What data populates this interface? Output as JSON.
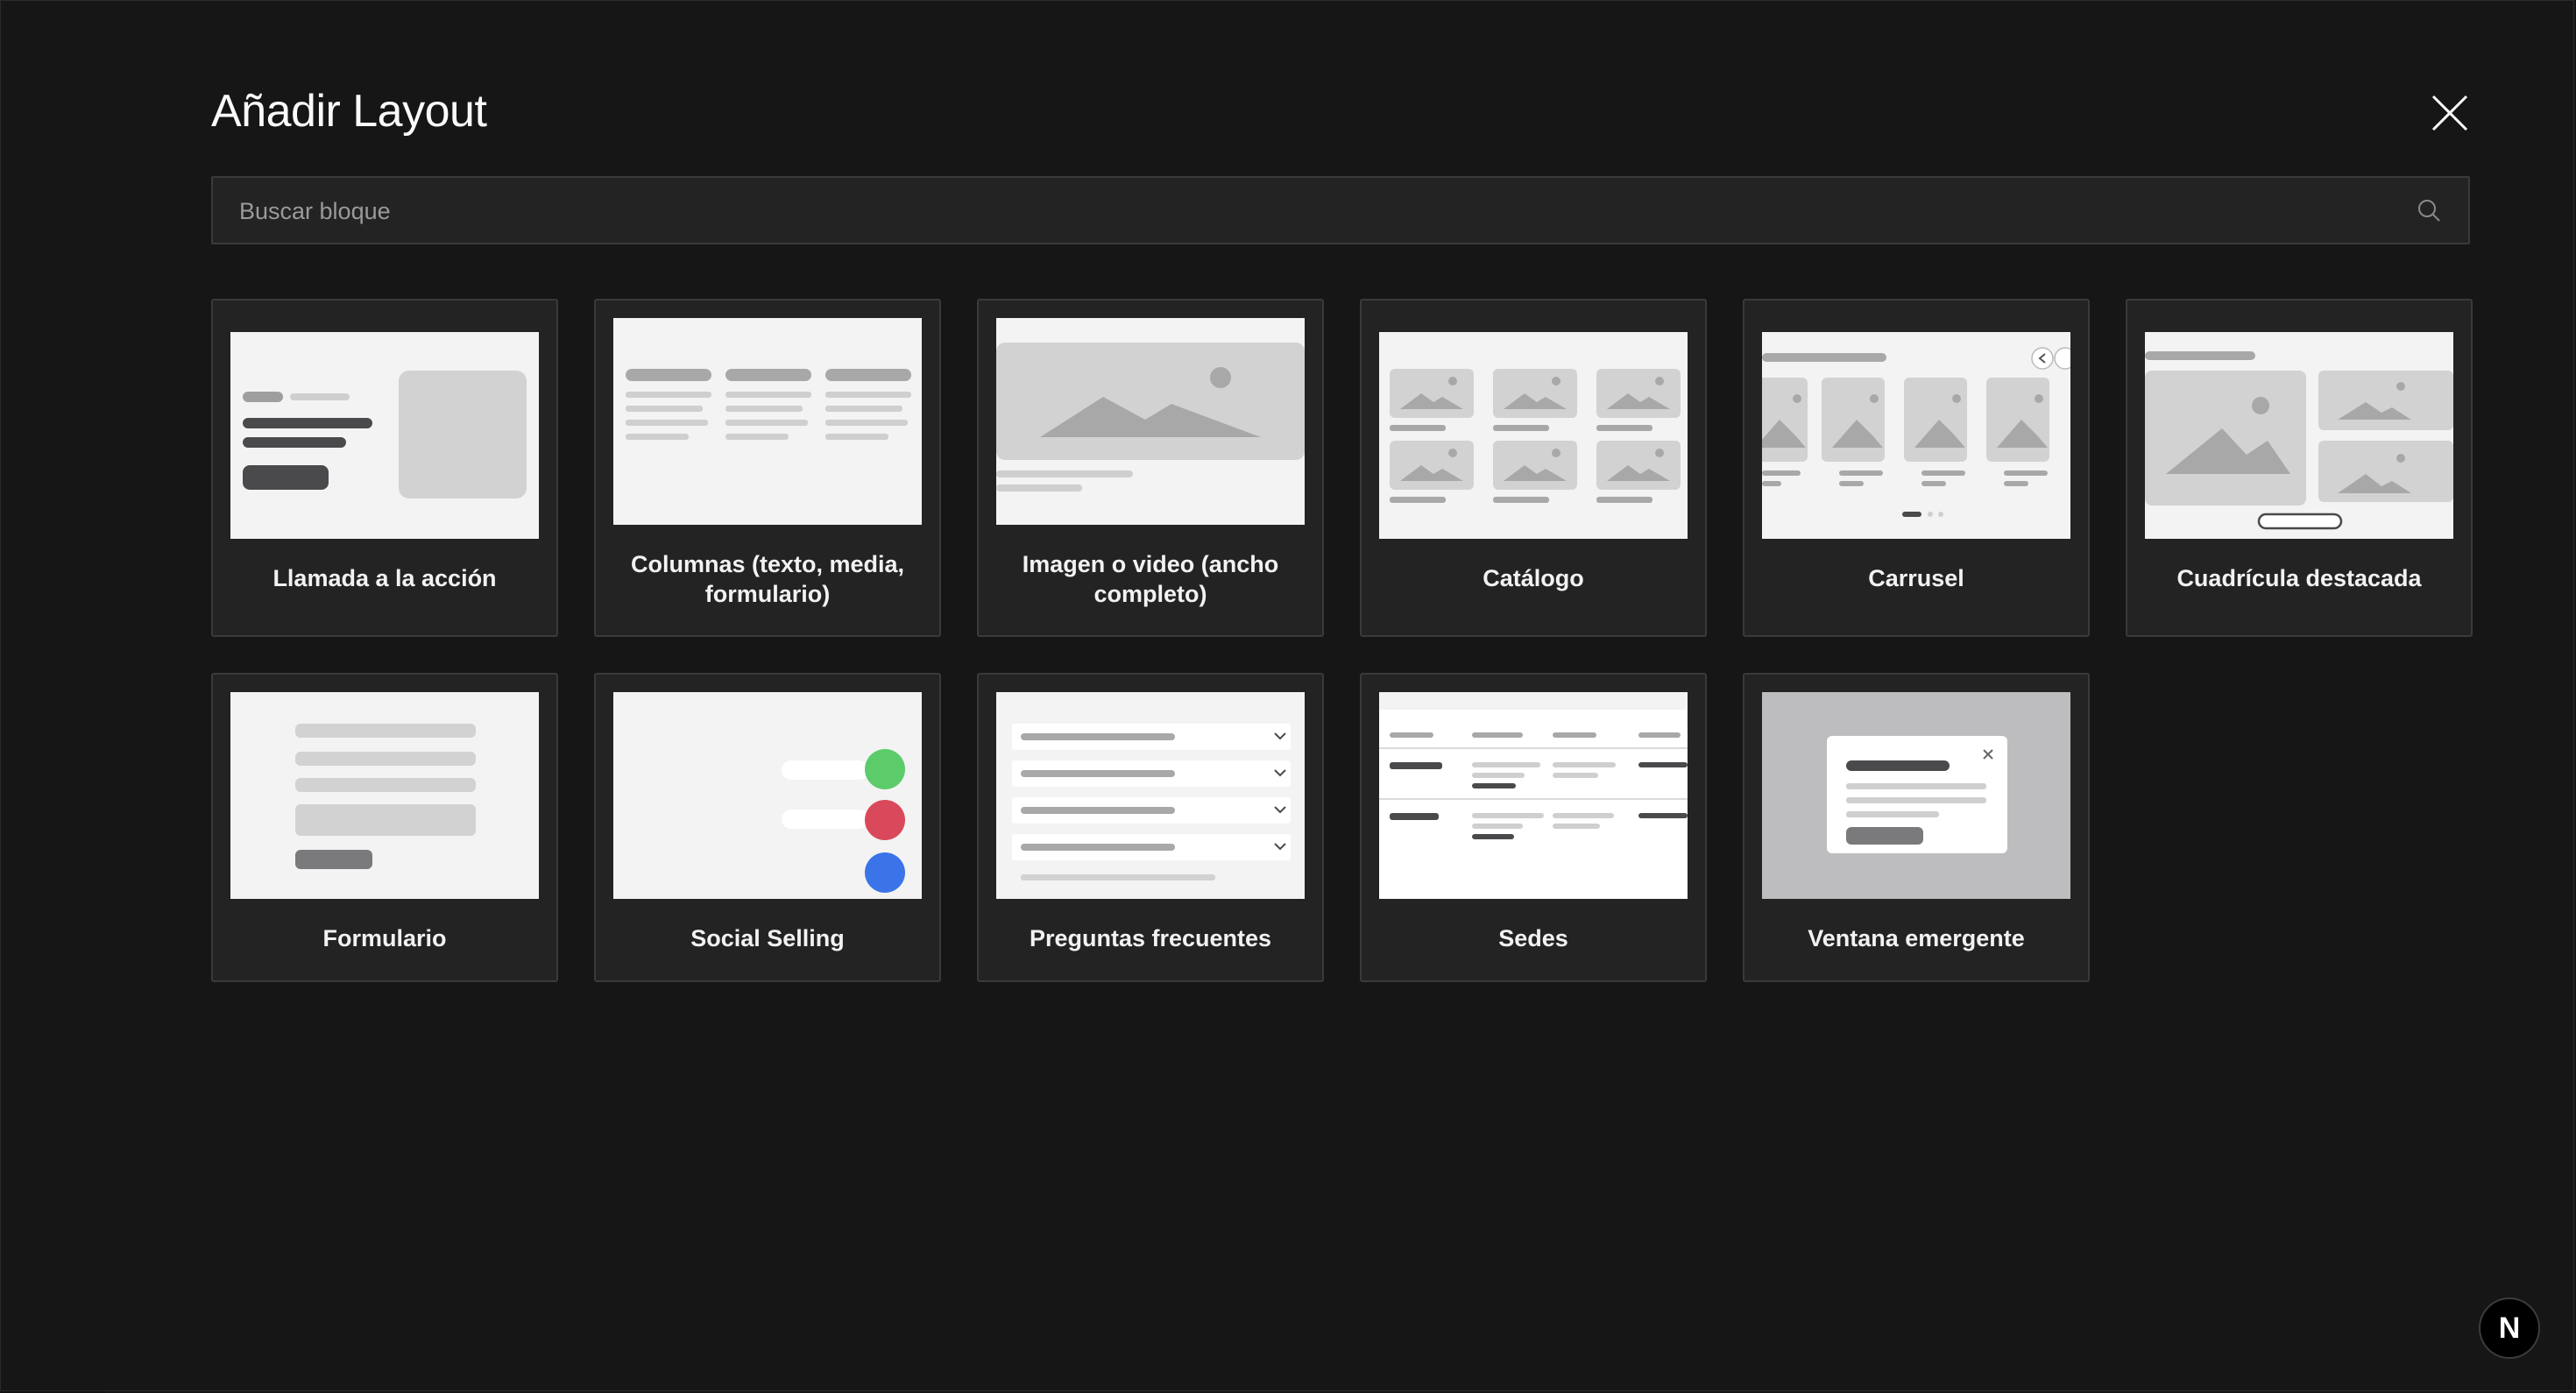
{
  "modal": {
    "title": "Añadir Layout",
    "close_icon": "close-icon"
  },
  "search": {
    "placeholder": "Buscar bloque",
    "value": "",
    "icon": "search-icon"
  },
  "blocks": [
    {
      "label": "Llamada a la acción"
    },
    {
      "label": "Columnas (texto, media, formulario)"
    },
    {
      "label": "Imagen o video (ancho completo)"
    },
    {
      "label": "Catálogo"
    },
    {
      "label": "Carrusel"
    },
    {
      "label": "Cuadrícula destacada"
    },
    {
      "label": "Formulario"
    },
    {
      "label": "Social Selling"
    },
    {
      "label": "Preguntas frecuentes"
    },
    {
      "label": "Sedes"
    },
    {
      "label": "Ventana emergente"
    }
  ],
  "badge": {
    "label": "N"
  },
  "colors": {
    "background": "#161616",
    "card": "#232323",
    "thumb": "#f3f3f3",
    "green": "#5ccb6a",
    "red": "#d9485b",
    "blue": "#3b74e8"
  }
}
